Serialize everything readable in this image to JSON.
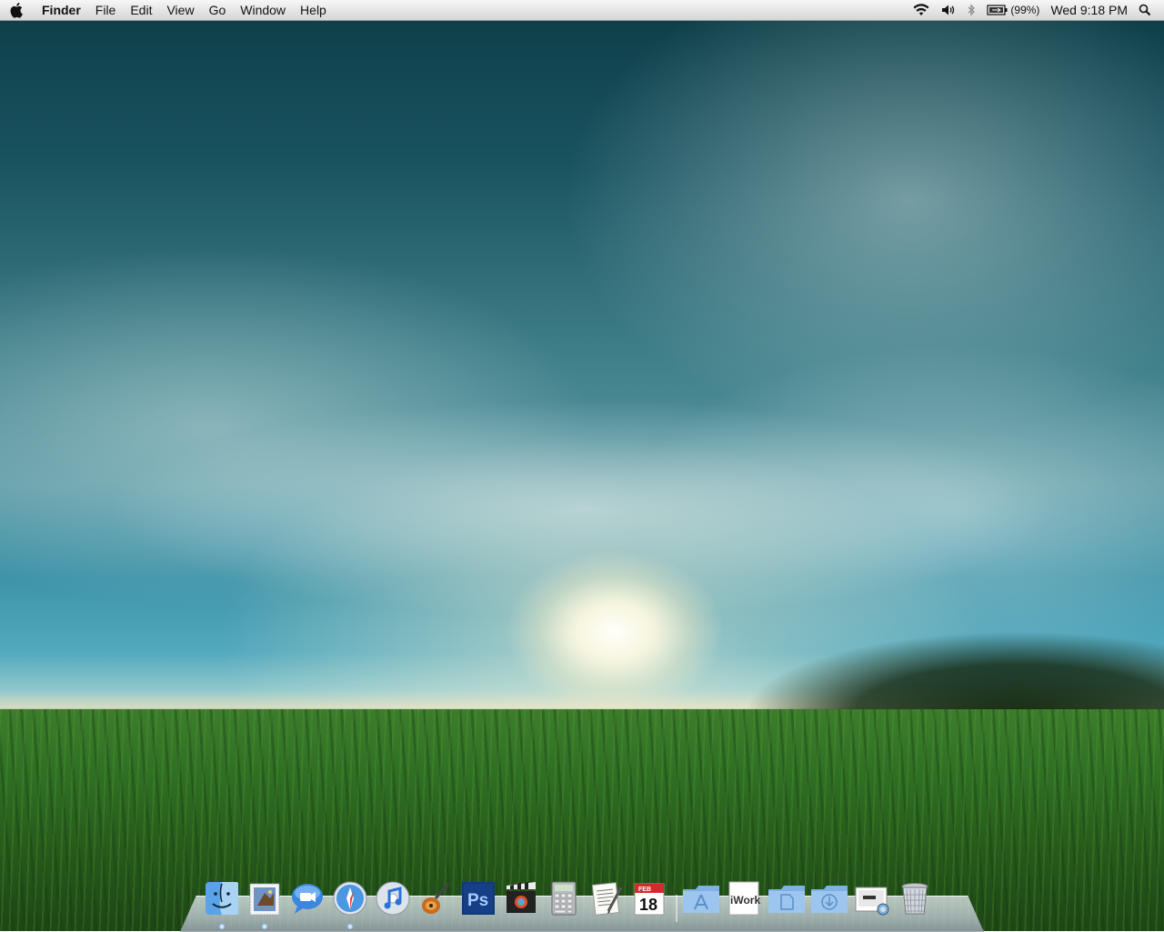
{
  "menubar": {
    "apple_icon": "apple-icon",
    "app_name": "Finder",
    "menus": [
      "File",
      "Edit",
      "View",
      "Go",
      "Window",
      "Help"
    ],
    "status": {
      "wifi_icon": "wifi-icon",
      "volume_icon": "volume-icon",
      "bluetooth_icon": "bluetooth-icon",
      "battery_icon": "battery-icon",
      "battery_percent": "(99%)",
      "clock": "Wed 9:18 PM",
      "spotlight_icon": "spotlight-icon"
    }
  },
  "dock": {
    "items": [
      {
        "name": "finder-icon"
      },
      {
        "name": "mail-icon"
      },
      {
        "name": "ichat-icon"
      },
      {
        "name": "safari-icon"
      },
      {
        "name": "itunes-icon"
      },
      {
        "name": "garageband-icon"
      },
      {
        "name": "photoshop-icon",
        "label": "Ps"
      },
      {
        "name": "imovie-icon"
      },
      {
        "name": "calculator-icon"
      },
      {
        "name": "textedit-icon"
      },
      {
        "name": "ical-icon",
        "label": "18",
        "month": "FEB"
      },
      {
        "name": "applications-folder-icon"
      },
      {
        "name": "iwork-icon",
        "label": "iWork"
      },
      {
        "name": "documents-folder-icon"
      },
      {
        "name": "downloads-folder-icon"
      },
      {
        "name": "preview-icon"
      },
      {
        "name": "trash-icon"
      }
    ],
    "colors": {
      "folder": "#7fb2e3",
      "photoshop": "#0e3a7a",
      "ical_red": "#d42a2a"
    }
  }
}
